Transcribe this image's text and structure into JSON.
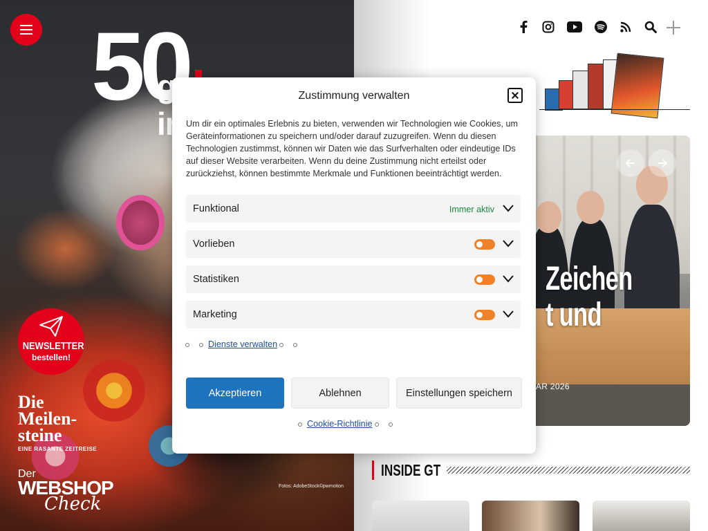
{
  "hero": {
    "logo_number": "50",
    "logo_text": "gt info",
    "newsletter": {
      "line1": "NEWSLETTER",
      "line2": "bestellen!"
    },
    "milestones": {
      "title": "Die Meilen-steine",
      "subtitle": "EINE RASANTE ZEITREISE"
    },
    "webshop": {
      "line1": "Der",
      "line2": "WEBSHOP",
      "line3": "Check"
    },
    "photo_credit": "Fotos: AdobeStock©pwmotion"
  },
  "nav": {
    "icons": [
      "facebook-icon",
      "instagram-icon",
      "youtube-icon",
      "spotify-icon",
      "rss-icon",
      "search-icon"
    ]
  },
  "slider": {
    "headline_line1": "Zeichen",
    "headline_line2": "t und",
    "date": "AR 2026"
  },
  "inside": {
    "title": "INSIDE GT"
  },
  "consent": {
    "title": "Zustimmung verwalten",
    "description": "Um dir ein optimales Erlebnis zu bieten, verwenden wir Technologien wie Cookies, um Geräteinformationen zu speichern und/oder darauf zuzugreifen. Wenn du diesen Technologien zustimmst, können wir Daten wie das Surfverhalten oder eindeutige IDs auf dieser Website verarbeiten. Wenn du deine Zustimmung nicht erteilst oder zurückziehst, können bestimmte Merkmale und Funktionen beeinträchtigt werden.",
    "categories": [
      {
        "name": "Funktional",
        "status": "Immer aktiv"
      },
      {
        "name": "Vorlieben"
      },
      {
        "name": "Statistiken"
      },
      {
        "name": "Marketing"
      }
    ],
    "manage_services": "Dienste verwalten",
    "accept": "Akzeptieren",
    "deny": "Ablehnen",
    "save": "Einstellungen speichern",
    "cookie_policy": "Cookie-Richtlinie",
    "toggle_color": "#f08128",
    "accept_color": "#1e73be"
  },
  "colors": {
    "brand_red": "#e3001b"
  }
}
